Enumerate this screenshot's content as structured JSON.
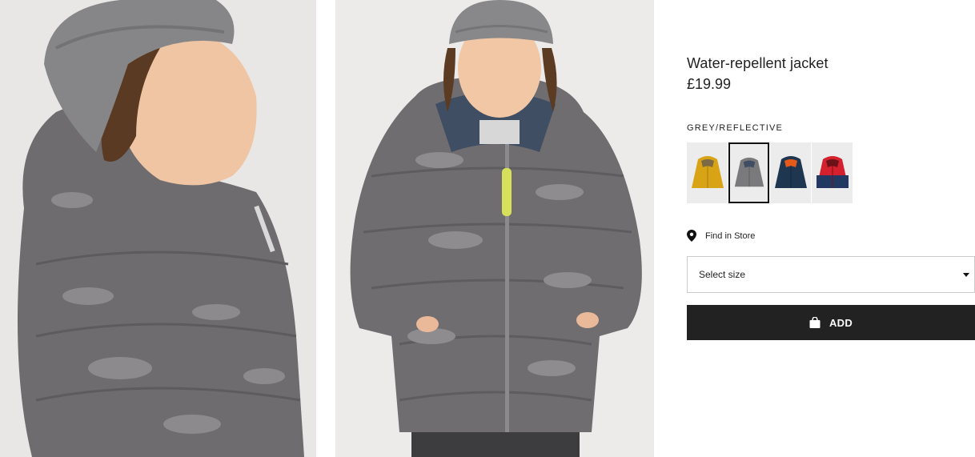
{
  "product": {
    "title": "Water-repellent jacket",
    "price": "£19.99",
    "color_name": "GREY/REFLECTIVE",
    "selected_color_index": 1,
    "swatches": [
      {
        "name": "yellow",
        "color": "#d9a316"
      },
      {
        "name": "grey-reflective",
        "color": "#7a7a7c"
      },
      {
        "name": "dark-blue",
        "color": "#1f3650"
      },
      {
        "name": "red-blue",
        "color": "#d5202d"
      }
    ]
  },
  "store": {
    "label": "Find in Store",
    "icon": "location-pin-icon"
  },
  "size_select": {
    "label": "Select size",
    "icon": "caret-down-icon"
  },
  "add_button": {
    "label": "ADD",
    "icon": "shopping-bag-icon"
  },
  "images": [
    {
      "name": "child-side-view-photo"
    },
    {
      "name": "child-front-view-photo"
    }
  ],
  "colors": {
    "accent": "#222222",
    "jacket": "#6e6c6f",
    "hat": "#8a8a8c",
    "background": "#e8e6e4"
  }
}
